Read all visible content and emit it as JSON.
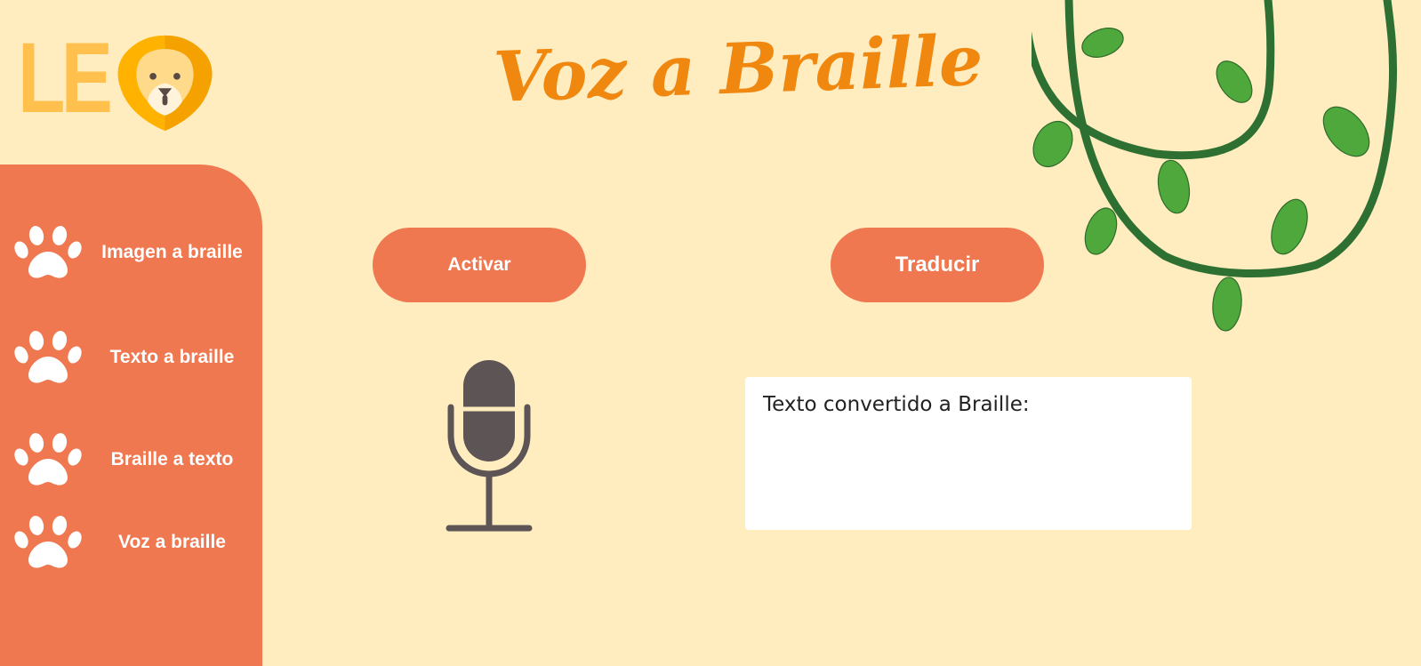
{
  "app": {
    "logo_text": "LE",
    "title": "Voz a Braille"
  },
  "sidebar": {
    "items": [
      {
        "label": "Imagen a braille",
        "icon": "paw-icon"
      },
      {
        "label": "Texto a braille",
        "icon": "paw-icon"
      },
      {
        "label": "Braille a texto",
        "icon": "paw-icon"
      },
      {
        "label": "Voz a braille",
        "icon": "paw-icon"
      }
    ]
  },
  "main": {
    "activate_label": "Activar",
    "translate_label": "Traducir",
    "mic_icon": "microphone-icon",
    "output_text": "Texto convertido a Braille:"
  },
  "colors": {
    "background": "#FFEDC0",
    "accent": "#EF7850",
    "title": "#F0870F",
    "logo": "#FFC04D",
    "vine": "#2E7031",
    "leaf": "#4EA83C",
    "mic": "#5C5455"
  }
}
